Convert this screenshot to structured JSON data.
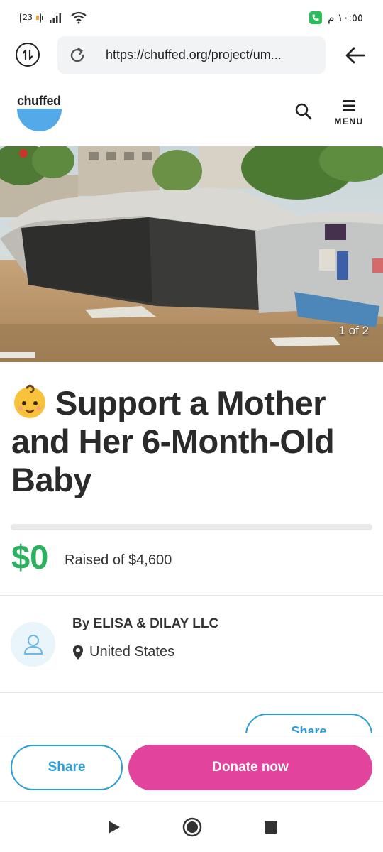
{
  "status_bar": {
    "battery": "23",
    "time": "١٠:٥٥ م"
  },
  "browser": {
    "url": "https://chuffed.org/project/um...",
    "site_info_icon": "site-info-icon",
    "reload_icon": "reload-icon",
    "back_icon": "arrow-left-icon"
  },
  "site": {
    "logo_text": "chuffed",
    "brand_color": "#54a9e8",
    "menu_label": "MENU"
  },
  "hero": {
    "counter": "1 of 2"
  },
  "campaign": {
    "title": "Support a Mother and Her 6-Month-Old Baby",
    "emoji": "baby-face-emoji",
    "raised": "$0",
    "raised_label": "Raised of $4,600",
    "progress_fraction": 0,
    "accent_color": "#2bb15f"
  },
  "organizer": {
    "by": "By ELISA & DILAY LLC",
    "location": "United States"
  },
  "actions": {
    "share_partial": "Share",
    "share": "Share",
    "donate": "Donate now",
    "share_color": "#2a9fd6",
    "donate_color": "#e2439c"
  }
}
